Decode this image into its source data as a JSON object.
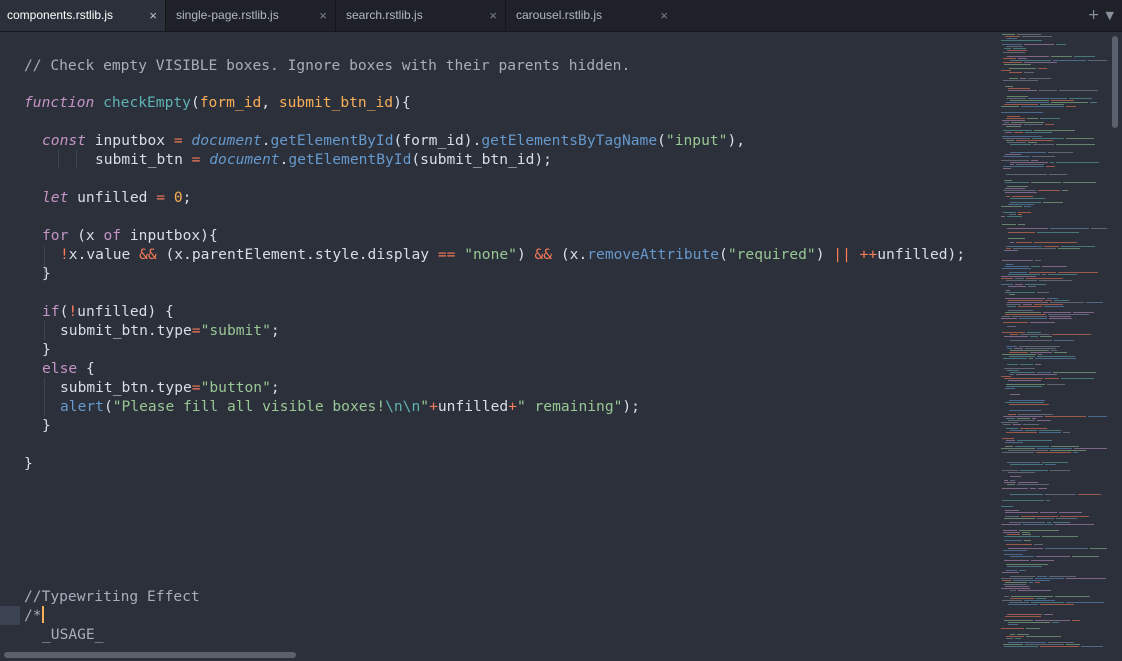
{
  "tabs": [
    {
      "label": "components.rstlib.js",
      "active": true,
      "close": "×"
    },
    {
      "label": "single-page.rstlib.js",
      "active": false,
      "close": "×"
    },
    {
      "label": "search.rstlib.js",
      "active": false,
      "close": "×"
    },
    {
      "label": "carousel.rstlib.js",
      "active": false,
      "close": "×"
    }
  ],
  "tabbar_controls": {
    "new_tab": "+",
    "menu": "▼"
  },
  "theme": {
    "background": "#2b303b",
    "tabbar": "#1e2128",
    "comment": "#a7adba",
    "keyword": "#c594c5",
    "function": "#5fb3b3",
    "string": "#99c794",
    "operator": "#f97b58",
    "number": "#f9ae58",
    "caret": "#f9ae58"
  },
  "code": {
    "line1": {
      "t1": "// Check empty VISIBLE boxes. Ignore boxes with their parents hidden."
    },
    "line3": {
      "t1": "function",
      "t2": " ",
      "t3": "checkEmpty",
      "t4": "(",
      "t5": "form_id",
      "t6": ", ",
      "t7": "submit_btn_id",
      "t8": "){"
    },
    "line5": {
      "t1": "const",
      "t2": " inputbox ",
      "t3": "=",
      "t4": " ",
      "t5": "document",
      "t6": ".",
      "t7": "getElementById",
      "t8": "(form_id).",
      "t9": "getElementsByTagName",
      "t10": "(",
      "t11": "\"input\"",
      "t12": "),"
    },
    "line6": {
      "t1": "submit_btn ",
      "t2": "=",
      "t3": " ",
      "t4": "document",
      "t5": ".",
      "t6": "getElementById",
      "t7": "(submit_btn_id);"
    },
    "line8": {
      "t1": "let",
      "t2": " unfilled ",
      "t3": "=",
      "t4": " ",
      "t5": "0",
      "t6": ";"
    },
    "line10": {
      "t1": "for",
      "t2": " (x ",
      "t3": "of",
      "t4": " inputbox){"
    },
    "line11": {
      "t1": "!",
      "t2": "x.value ",
      "t3": "&&",
      "t4": " (x.parentElement.style.display ",
      "t5": "==",
      "t6": " ",
      "t7": "\"none\"",
      "t8": ") ",
      "t9": "&&",
      "t10": " (x.",
      "t11": "removeAttribute",
      "t12": "(",
      "t13": "\"required\"",
      "t14": ") ",
      "t15": "||",
      "t16": " ",
      "t17": "++",
      "t18": "unfilled);"
    },
    "line12": {
      "t1": "}"
    },
    "line14": {
      "t1": "if",
      "t2": "(",
      "t3": "!",
      "t4": "unfilled) {"
    },
    "line15": {
      "t1": "submit_btn.type",
      "t2": "=",
      "t3": "\"submit\"",
      "t4": ";"
    },
    "line16": {
      "t1": "}"
    },
    "line17": {
      "t1": "else",
      "t2": " {"
    },
    "line18": {
      "t1": "submit_btn.type",
      "t2": "=",
      "t3": "\"button\"",
      "t4": ";"
    },
    "line19": {
      "t1": "alert",
      "t2": "(",
      "t3": "\"Please fill all visible boxes!",
      "t4": "\\n\\n",
      "t5": "\"",
      "t6": "+",
      "t7": "unfilled",
      "t8": "+",
      "t9": "\" remaining\"",
      "t10": ");"
    },
    "line20": {
      "t1": "}"
    },
    "line22": {
      "t1": "}"
    },
    "line30": {
      "t1": "//Typewriting Effect"
    },
    "line31": {
      "t1": "/*"
    },
    "line32": {
      "t1": "_USAGE_"
    }
  }
}
